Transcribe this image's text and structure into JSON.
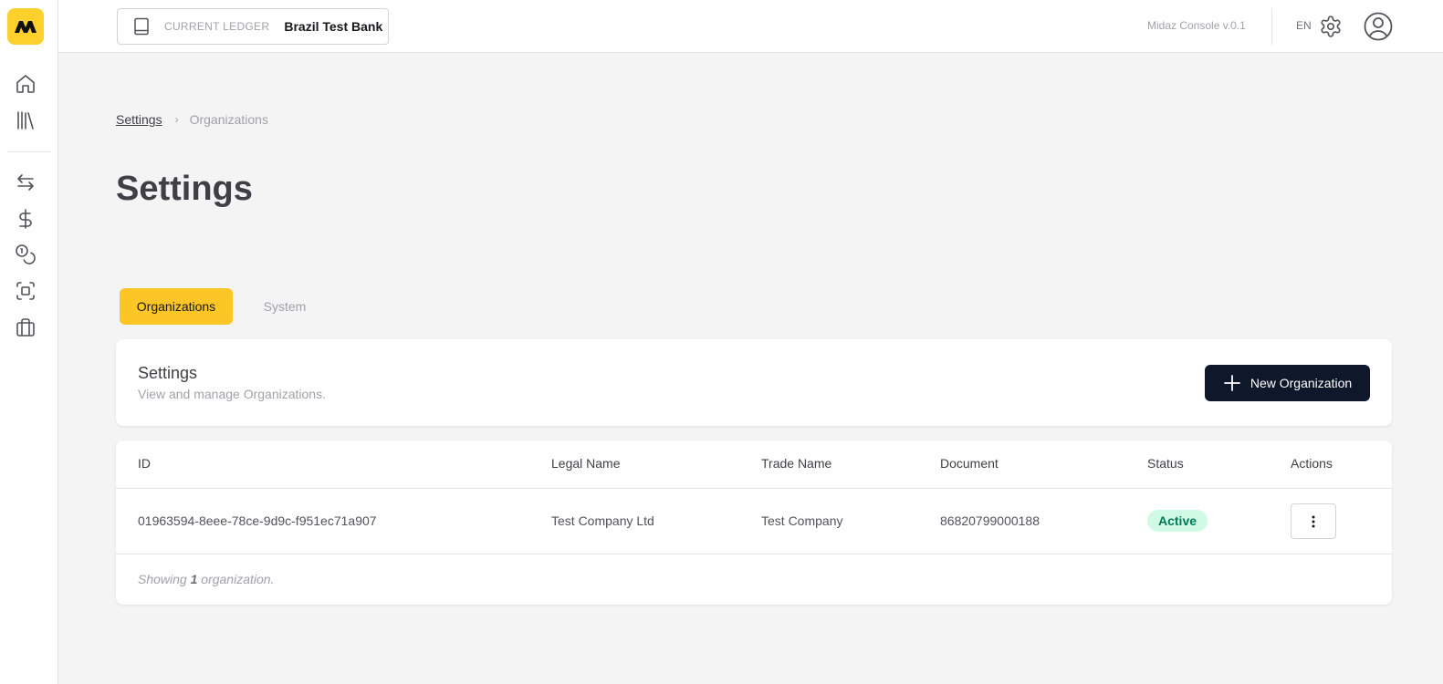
{
  "topbar": {
    "ledger_label": "CURRENT LEDGER",
    "ledger_name": "Brazil Test Bank",
    "version": "Midaz Console v.0.1",
    "language": "EN"
  },
  "breadcrumb": {
    "root": "Settings",
    "separator": "›",
    "current": "Organizations"
  },
  "page": {
    "title": "Settings"
  },
  "tabs": [
    {
      "label": "Organizations",
      "active": true
    },
    {
      "label": "System",
      "active": false
    }
  ],
  "header_card": {
    "title": "Settings",
    "description": "View and manage Organizations.",
    "new_button_label": "New Organization"
  },
  "table": {
    "columns": [
      "ID",
      "Legal Name",
      "Trade Name",
      "Document",
      "Status",
      "Actions"
    ],
    "rows": [
      {
        "id": "01963594-8eee-78ce-9d9c-f951ec71a907",
        "legal_name": "Test Company Ltd",
        "trade_name": "Test Company",
        "document": "86820799000188",
        "status": "Active"
      }
    ],
    "footer_prefix": "Showing",
    "footer_count": "1",
    "footer_suffix": "organization."
  },
  "colors": {
    "brand_yellow": "#fcc626",
    "primary_dark": "#0f172a",
    "status_active_bg": "#d1fae5",
    "status_active_text": "#047857"
  },
  "icons": {
    "sidebar": [
      "home-icon",
      "library-icon",
      "transfer-icon",
      "dollar-icon",
      "coins-icon",
      "scan-icon",
      "briefcase-icon"
    ],
    "topbar": [
      "book-icon",
      "gear-icon",
      "user-circle-icon"
    ]
  }
}
